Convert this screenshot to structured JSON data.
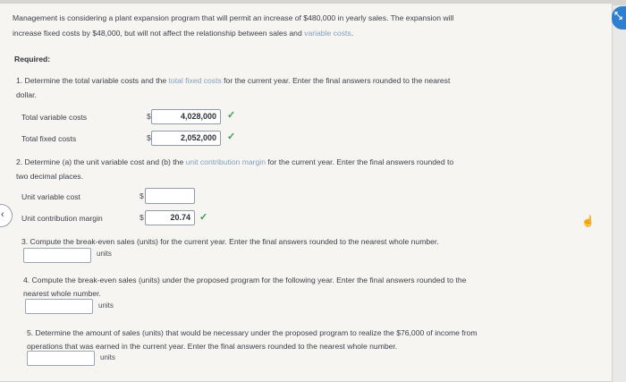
{
  "intro": {
    "line1": "Management is considering a plant expansion program that will permit an increase of $480,000 in yearly sales. The expansion will",
    "line2_a": "increase fixed costs by $48,000, but will not affect the relationship between sales and ",
    "line2_link": "variable costs",
    "line2_b": "."
  },
  "required_label": "Required:",
  "q1": {
    "line1_a": "1. Determine the total variable costs and the ",
    "line1_link": "total fixed costs",
    "line1_b": " for the current year. Enter the final answers rounded to the nearest",
    "line2": "dollar.",
    "rows": [
      {
        "label": "Total variable costs",
        "currency": "$",
        "value": "4,028,000",
        "check": "✓"
      },
      {
        "label": "Total fixed costs",
        "currency": "$",
        "value": "2,052,000",
        "check": "✓"
      }
    ]
  },
  "q2": {
    "line1_a": "2. Determine (a) the unit variable cost and (b) the ",
    "line1_link": "unit contribution margin",
    "line1_b": " for the current year. Enter the final answers rounded to",
    "line2": "two decimal places.",
    "rows": [
      {
        "label": "Unit variable cost",
        "currency": "$",
        "value": "",
        "check": ""
      },
      {
        "label": "Unit contribution margin",
        "currency": "$",
        "value": "20.74",
        "check": "✓"
      }
    ]
  },
  "q3": {
    "line1": "3. Compute the break-even sales (units) for the current year. Enter the final answers rounded to the nearest whole number.",
    "unit": "units"
  },
  "q4": {
    "line1": "4. Compute the break-even sales (units) under the proposed program for the following year. Enter the final answers rounded to the",
    "line2": "nearest whole number.",
    "unit": "units"
  },
  "q5": {
    "line1": "5. Determine the amount of sales (units) that would be necessary under the proposed program to realize the $76,000 of income from",
    "line2": "operations that was earned in the current year. Enter the final answers rounded to the nearest whole number.",
    "unit": "units"
  },
  "icons": {
    "side_tab": "‹",
    "hand": "☝",
    "corner": "⤡"
  },
  "colors": {
    "check": "#3d9b4a",
    "link": "#7f9fbf",
    "corner_icon": "#2f7fd0"
  }
}
